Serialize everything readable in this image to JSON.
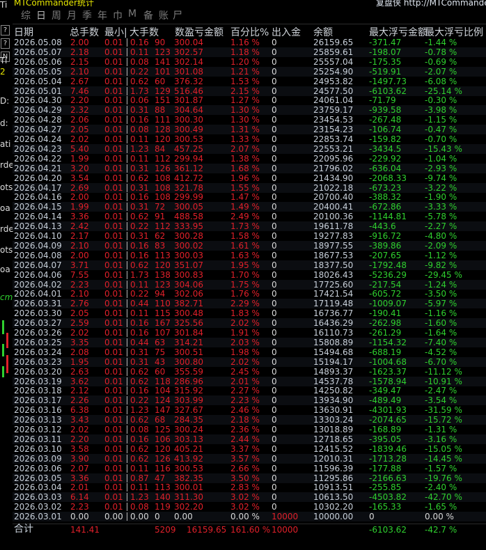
{
  "app_title": "MTCommander统计",
  "right_title": "复盘侠 http://MTCommander",
  "left_tools": [
    "Ti",
    "?",
    "?",
    "N",
    "Ti",
    "2",
    "D:",
    "d:",
    "ati",
    "rde",
    "ots",
    "oa",
    "rde",
    "ots",
    "oa",
    "cm"
  ],
  "periods": [
    "综",
    "日",
    "周",
    "月",
    "季",
    "年",
    "巾",
    "M",
    "备",
    "账",
    "尸"
  ],
  "headers": [
    "日期",
    "总手数",
    "最小|",
    "大手数",
    "数盈亏金额",
    "百分比%",
    "出入金",
    "余额",
    "最大浮亏金额",
    "最大浮亏比例"
  ],
  "rows": [
    [
      "2026.05.08",
      "2.00",
      "0.01",
      "0.16",
      "90",
      "300.04",
      "1.16 %",
      "0",
      "26159.65",
      "-371.47",
      "-1.44 %"
    ],
    [
      "2026.05.07",
      "2.18",
      "0.01",
      "0.11",
      "123",
      "302.57",
      "1.18 %",
      "0",
      "25859.61",
      "-198.07",
      "-0.78 %"
    ],
    [
      "2026.05.06",
      "2.15",
      "0.01",
      "0.08",
      "141",
      "302.14",
      "1.20 %",
      "0",
      "25557.04",
      "-175.35",
      "-0.69 %"
    ],
    [
      "2026.05.05",
      "2.10",
      "0.01",
      "0.22",
      "101",
      "301.08",
      "1.21 %",
      "0",
      "25254.90",
      "-519.91",
      "-2.07 %"
    ],
    [
      "2026.05.04",
      "2.67",
      "0.01",
      "0.62",
      "60",
      "376.32",
      "1.53 %",
      "0",
      "24953.82",
      "-1497.73",
      "-6.08 %"
    ],
    [
      "2026.05.01",
      "7.46",
      "0.01",
      "1.73",
      "129",
      "516.46",
      "2.15 %",
      "0",
      "24577.50",
      "-6103.62",
      "-25.14 %"
    ],
    [
      "2026.04.30",
      "2.20",
      "0.01",
      "0.06",
      "151",
      "301.87",
      "1.27 %",
      "0",
      "24061.04",
      "-71.79",
      "-0.30 %"
    ],
    [
      "2026.04.29",
      "2.32",
      "0.01",
      "0.31",
      "88",
      "304.64",
      "1.30 %",
      "0",
      "23759.17",
      "-939.58",
      "-3.98 %"
    ],
    [
      "2026.04.28",
      "2.06",
      "0.01",
      "0.16",
      "111",
      "300.30",
      "1.30 %",
      "0",
      "23454.53",
      "-267.48",
      "-1.15 %"
    ],
    [
      "2026.04.27",
      "2.05",
      "0.01",
      "0.08",
      "128",
      "300.49",
      "1.31 %",
      "0",
      "23154.23",
      "-106.74",
      "-0.47 %"
    ],
    [
      "2026.04.24",
      "2.02",
      "0.01",
      "0.11",
      "120",
      "300.53",
      "1.33 %",
      "0",
      "22853.74",
      "-159.82",
      "-0.70 %"
    ],
    [
      "2026.04.23",
      "5.40",
      "0.01",
      "1.23",
      "84",
      "457.25",
      "2.07 %",
      "0",
      "22553.21",
      "-3434.5",
      "-15.43 %"
    ],
    [
      "2026.04.22",
      "1.99",
      "0.01",
      "0.11",
      "112",
      "299.94",
      "1.38 %",
      "0",
      "22095.96",
      "-229.92",
      "-1.04 %"
    ],
    [
      "2026.04.21",
      "3.20",
      "0.01",
      "0.31",
      "126",
      "361.12",
      "1.68 %",
      "0",
      "21796.02",
      "-636.04",
      "-2.93 %"
    ],
    [
      "2026.04.20",
      "3.54",
      "0.01",
      "0.62",
      "108",
      "412.72",
      "1.96 %",
      "0",
      "21434.90",
      "-2068.33",
      "-9.74 %"
    ],
    [
      "2026.04.17",
      "2.69",
      "0.01",
      "0.31",
      "108",
      "321.78",
      "1.55 %",
      "0",
      "21022.18",
      "-673.23",
      "-3.22 %"
    ],
    [
      "2026.04.16",
      "2.00",
      "0.01",
      "0.16",
      "108",
      "299.99",
      "1.47 %",
      "0",
      "20700.40",
      "-388.32",
      "-1.90 %"
    ],
    [
      "2026.04.15",
      "1.99",
      "0.01",
      "0.31",
      "72",
      "300.05",
      "1.49 %",
      "0",
      "20400.41",
      "-672.86",
      "-3.33 %"
    ],
    [
      "2026.04.14",
      "3.36",
      "0.01",
      "0.62",
      "91",
      "488.58",
      "2.49 %",
      "0",
      "20100.36",
      "-1144.81",
      "-5.78 %"
    ],
    [
      "2026.04.13",
      "2.42",
      "0.01",
      "0.22",
      "112",
      "333.95",
      "1.73 %",
      "0",
      "19611.78",
      "-443.6",
      "-2.27 %"
    ],
    [
      "2026.04.10",
      "2.17",
      "0.01",
      "0.31",
      "62",
      "300.28",
      "1.58 %",
      "0",
      "19277.83",
      "-916.72",
      "-4.80 %"
    ],
    [
      "2026.04.09",
      "2.10",
      "0.01",
      "0.16",
      "83",
      "300.02",
      "1.61 %",
      "0",
      "18977.55",
      "-389.86",
      "-2.09 %"
    ],
    [
      "2026.04.08",
      "2.00",
      "0.01",
      "0.16",
      "113",
      "300.03",
      "1.63 %",
      "0",
      "18677.53",
      "-207.65",
      "-1.12 %"
    ],
    [
      "2026.04.07",
      "3.71",
      "0.01",
      "0.62",
      "120",
      "351.07",
      "1.95 %",
      "0",
      "18377.50",
      "-1792.48",
      "-9.82 %"
    ],
    [
      "2026.04.06",
      "7.55",
      "0.01",
      "1.73",
      "138",
      "300.83",
      "1.70 %",
      "0",
      "18026.43",
      "-5236.29",
      "-29.45 %"
    ],
    [
      "2026.04.02",
      "2.23",
      "0.01",
      "0.11",
      "123",
      "304.06",
      "1.75 %",
      "0",
      "17725.60",
      "-217.54",
      "-1.24 %"
    ],
    [
      "2026.04.01",
      "2.10",
      "0.01",
      "0.22",
      "94",
      "302.06",
      "1.76 %",
      "0",
      "17421.54",
      "-605.72",
      "-3.50 %"
    ],
    [
      "2026.03.31",
      "2.76",
      "0.01",
      "0.44",
      "110",
      "382.71",
      "2.29 %",
      "0",
      "17119.48",
      "-1009.07",
      "-5.97 %"
    ],
    [
      "2026.03.30",
      "2.05",
      "0.01",
      "0.11",
      "115",
      "300.48",
      "1.83 %",
      "0",
      "16736.77",
      "-190.41",
      "-1.16 %"
    ],
    [
      "2026.03.27",
      "2.59",
      "0.01",
      "0.16",
      "167",
      "325.56",
      "2.02 %",
      "0",
      "16436.29",
      "-262.98",
      "-1.60 %"
    ],
    [
      "2026.03.26",
      "2.02",
      "0.01",
      "0.16",
      "107",
      "301.84",
      "1.91 %",
      "0",
      "16110.73",
      "-261.29",
      "-1.64 %"
    ],
    [
      "2026.03.25",
      "3.35",
      "0.01",
      "0.44",
      "63",
      "314.21",
      "2.03 %",
      "0",
      "15808.89",
      "-1154.32",
      "-7.40 %"
    ],
    [
      "2026.03.24",
      "2.08",
      "0.01",
      "0.31",
      "75",
      "300.51",
      "1.98 %",
      "0",
      "15494.68",
      "-688.19",
      "-4.52 %"
    ],
    [
      "2026.03.23",
      "1.95",
      "0.01",
      "0.31",
      "43",
      "300.80",
      "2.02 %",
      "0",
      "15194.17",
      "-1004.68",
      "-6.70 %"
    ],
    [
      "2026.03.20",
      "2.63",
      "0.01",
      "0.62",
      "60",
      "355.59",
      "2.45 %",
      "0",
      "14893.37",
      "-1623.37",
      "-11.12 %"
    ],
    [
      "2026.03.19",
      "3.62",
      "0.01",
      "0.62",
      "118",
      "286.96",
      "2.01 %",
      "0",
      "14537.78",
      "-1578.94",
      "-10.91 %"
    ],
    [
      "2026.03.18",
      "2.12",
      "0.01",
      "0.16",
      "104",
      "315.92",
      "2.27 %",
      "0",
      "14250.82",
      "-349.47",
      "-2.47 %"
    ],
    [
      "2026.03.17",
      "2.26",
      "0.01",
      "0.22",
      "124",
      "303.99",
      "2.23 %",
      "0",
      "13934.90",
      "-489.49",
      "-3.54 %"
    ],
    [
      "2026.03.16",
      "6.38",
      "0.01",
      "1.23",
      "147",
      "327.67",
      "2.46 %",
      "0",
      "13630.91",
      "-4301.93",
      "-31.59 %"
    ],
    [
      "2026.03.13",
      "3.43",
      "0.01",
      "0.62",
      "68",
      "284.35",
      "2.18 %",
      "0",
      "13303.24",
      "-2074.65",
      "-15.72 %"
    ],
    [
      "2026.03.12",
      "2.02",
      "0.01",
      "0.08",
      "125",
      "300.24",
      "2.36 %",
      "0",
      "13018.89",
      "-168.89",
      "-1.31 %"
    ],
    [
      "2026.03.11",
      "2.20",
      "0.01",
      "0.16",
      "106",
      "303.13",
      "2.44 %",
      "0",
      "12718.65",
      "-395.05",
      "-3.16 %"
    ],
    [
      "2026.03.10",
      "3.58",
      "0.01",
      "0.62",
      "120",
      "405.21",
      "3.37 %",
      "0",
      "12415.52",
      "-1839.46",
      "-15.05 %"
    ],
    [
      "2026.03.09",
      "3.90",
      "0.01",
      "0.62",
      "126",
      "413.92",
      "3.57 %",
      "0",
      "12010.31",
      "-1713.28",
      "-14.45 %"
    ],
    [
      "2026.03.06",
      "2.07",
      "0.01",
      "0.11",
      "116",
      "300.53",
      "2.66 %",
      "0",
      "11596.39",
      "-177.88",
      "-1.57 %"
    ],
    [
      "2026.03.05",
      "3.36",
      "0.01",
      "0.87",
      "47",
      "382.35",
      "3.50 %",
      "0",
      "11295.86",
      "-2166.63",
      "-19.76 %"
    ],
    [
      "2026.03.04",
      "2.01",
      "0.01",
      "0.11",
      "113",
      "300.01",
      "2.83 %",
      "0",
      "10913.51",
      "-255.85",
      "-2.40 %"
    ],
    [
      "2026.03.03",
      "6.14",
      "0.01",
      "1.23",
      "140",
      "311.30",
      "3.02 %",
      "0",
      "10613.50",
      "-4503.82",
      "-42.70 %"
    ],
    [
      "2026.03.02",
      "2.23",
      "0.01",
      "0.08",
      "119",
      "302.20",
      "3.02 %",
      "0",
      "10302.20",
      "-165.33",
      "-1.65 %"
    ],
    [
      "2026.03.01",
      "0.00",
      "0.00",
      "0.00",
      "0",
      "0.00",
      "0.00 %",
      "10000",
      "10000.00",
      "0",
      "0.00 %"
    ]
  ],
  "summary": {
    "label": "合计",
    "total_lots": "141.41",
    "count": "5209",
    "profit": "16159.65",
    "pct": "161.60 %",
    "inout": "10000",
    "max_float": "-6103.62",
    "max_float_pct": "-42.7 %"
  },
  "colors": {
    "loss": "#e0202a",
    "gain": "#2fd02f",
    "text": "#c8d0da"
  }
}
